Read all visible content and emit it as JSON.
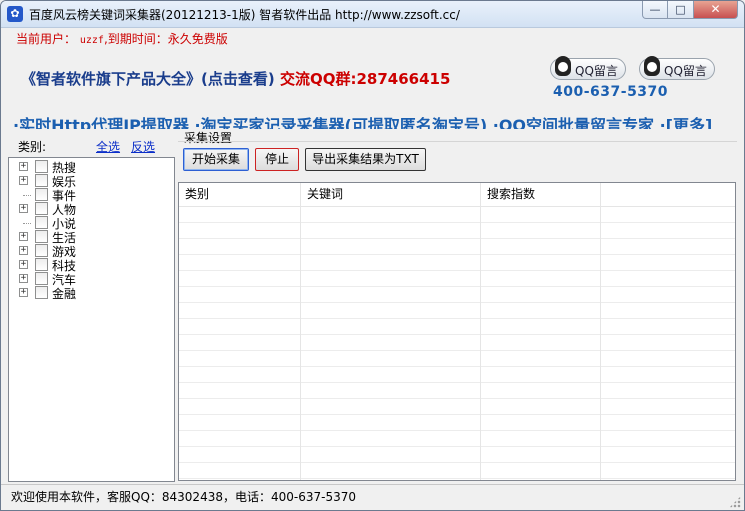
{
  "window": {
    "title": "百度风云榜关键词采集器(20121213-1版) 智者软件出品 http://www.zzsoft.cc/",
    "minimize_glyph": "—",
    "maximize_glyph": "□",
    "close_glyph": "✕"
  },
  "banner": {
    "user_prefix": "当前用户：",
    "user_name": "uzzf",
    "user_suffix": ",到期时间：永久免费版",
    "title_main": "《智者软件旗下产品大全》(点击查看)",
    "title_qq": "交流QQ群:287466415",
    "qq_button_1": "QQ留言",
    "qq_button_2": "QQ留言",
    "phone": "400-637-5370",
    "marquee": "·实时Http代理IP提取器 ·淘宝买家记录采集器(可提取匿名淘宝号) ·QQ空间批量留言专家 ·[更多]"
  },
  "left": {
    "category_label": "类别:",
    "select_all": "全选",
    "invert_select": "反选",
    "categories": [
      {
        "label": "热搜",
        "expandable": true
      },
      {
        "label": "娱乐",
        "expandable": true
      },
      {
        "label": "事件",
        "expandable": false
      },
      {
        "label": "人物",
        "expandable": true
      },
      {
        "label": "小说",
        "expandable": false
      },
      {
        "label": "生活",
        "expandable": true
      },
      {
        "label": "游戏",
        "expandable": true
      },
      {
        "label": "科技",
        "expandable": true
      },
      {
        "label": "汽车",
        "expandable": true
      },
      {
        "label": "金融",
        "expandable": true
      }
    ]
  },
  "right": {
    "settings_label": "采集设置",
    "start_button": "开始采集",
    "stop_button": "停止",
    "export_button": "导出采集结果为TXT",
    "columns": [
      "类别",
      "关键词",
      "搜索指数"
    ]
  },
  "status": {
    "text": "欢迎使用本软件，客服QQ：84302438，电话：400-637-5370"
  }
}
